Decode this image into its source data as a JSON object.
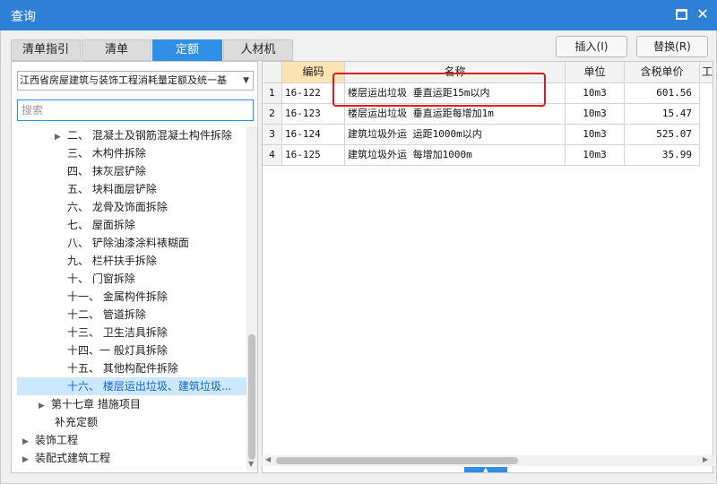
{
  "window": {
    "title": "查询"
  },
  "tabs": [
    {
      "label": "清单指引",
      "active": false
    },
    {
      "label": "清单",
      "active": false
    },
    {
      "label": "定额",
      "active": true
    },
    {
      "label": "人材机",
      "active": false
    }
  ],
  "actions": {
    "insert_label": "插入(I)",
    "replace_label": "替换(R)"
  },
  "left_panel": {
    "quota_library": "江西省房屋建筑与装饰工程消耗量定额及统一基",
    "search_placeholder": "搜索"
  },
  "tree": [
    {
      "label": "二、 混凝土及钢筋混凝土构件拆除",
      "expander": "▶",
      "selected": false
    },
    {
      "label": "三、 木构件拆除",
      "expander": "",
      "selected": false
    },
    {
      "label": "四、 抹灰层铲除",
      "expander": "",
      "selected": false
    },
    {
      "label": "五、 块料面层铲除",
      "expander": "",
      "selected": false
    },
    {
      "label": "六、 龙骨及饰面拆除",
      "expander": "",
      "selected": false
    },
    {
      "label": "七、 屋面拆除",
      "expander": "",
      "selected": false
    },
    {
      "label": "八、 铲除油漆涂料裱糊面",
      "expander": "",
      "selected": false
    },
    {
      "label": "九、 栏杆扶手拆除",
      "expander": "",
      "selected": false
    },
    {
      "label": "十、 门窗拆除",
      "expander": "",
      "selected": false
    },
    {
      "label": "十一、 金属构件拆除",
      "expander": "",
      "selected": false
    },
    {
      "label": "十二、 管道拆除",
      "expander": "",
      "selected": false
    },
    {
      "label": "十三、 卫生洁具拆除",
      "expander": "",
      "selected": false
    },
    {
      "label": "十四、一 般灯具拆除",
      "expander": "",
      "selected": false
    },
    {
      "label": "十五、 其他构配件拆除",
      "expander": "",
      "selected": false
    },
    {
      "label": "十六、 楼层运出垃圾、建筑垃圾...",
      "expander": "",
      "selected": true
    },
    {
      "label": "第十七章 措施项目",
      "expander": "▶",
      "selected": false
    },
    {
      "label": "补充定额",
      "expander": "",
      "selected": false
    },
    {
      "label": "装饰工程",
      "expander": "▶",
      "selected": false
    },
    {
      "label": "装配式建筑工程",
      "expander": "▶",
      "selected": false
    }
  ],
  "grid": {
    "columns": [
      "编码",
      "名称",
      "单位",
      "含税单价",
      "工"
    ],
    "rows": [
      {
        "no": "1",
        "code": "16-122",
        "name": "楼层运出垃圾 垂直运距15m以内",
        "unit": "10m3",
        "price": "601.56"
      },
      {
        "no": "2",
        "code": "16-123",
        "name": "楼层运出垃圾 垂直运距每增加1m",
        "unit": "10m3",
        "price": "15.47"
      },
      {
        "no": "3",
        "code": "16-124",
        "name": "建筑垃圾外运 运距1000m以内",
        "unit": "10m3",
        "price": "525.07"
      },
      {
        "no": "4",
        "code": "16-125",
        "name": "建筑垃圾外运 每增加1000m",
        "unit": "10m3",
        "price": "35.99"
      }
    ]
  },
  "colors": {
    "accent": "#2e8fe5",
    "titlebar": "#2e7fd6",
    "highlight_box": "#e21b1b",
    "selected_row": "#cce8ff"
  }
}
